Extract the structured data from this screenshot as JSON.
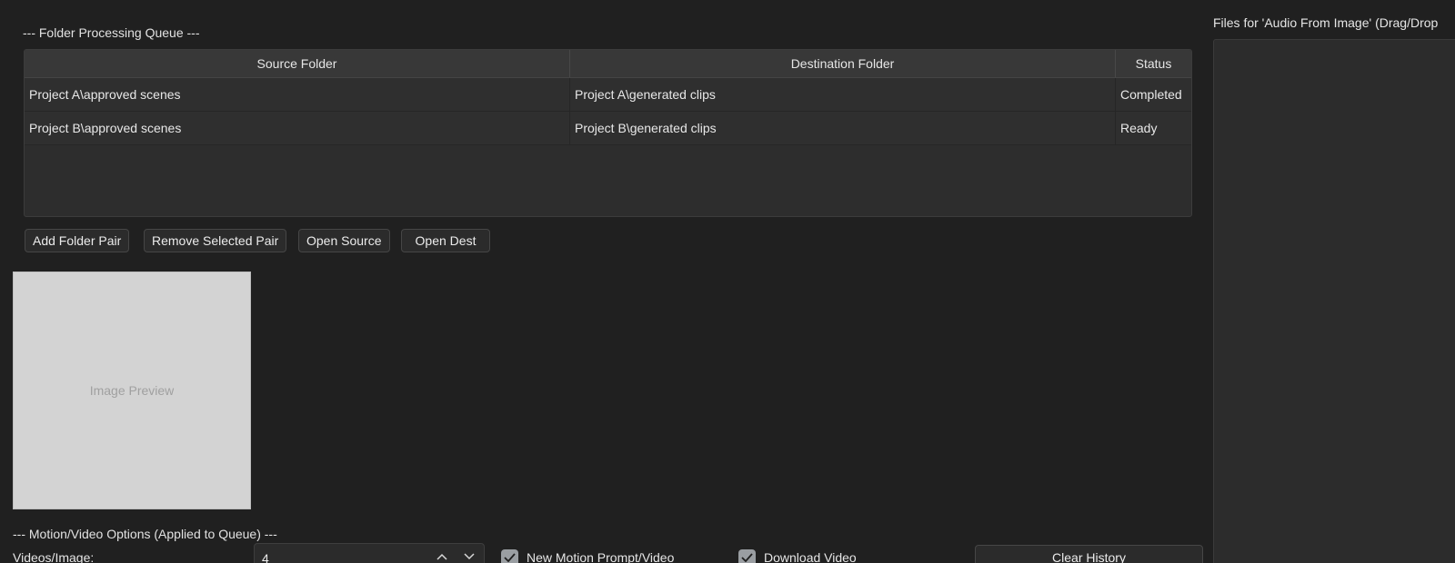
{
  "queue": {
    "title": "--- Folder Processing Queue ---",
    "columns": [
      "Source Folder",
      "Destination Folder",
      "Status"
    ],
    "rows": [
      {
        "source": "Project A\\approved scenes",
        "dest": "Project A\\generated clips",
        "status": "Completed"
      },
      {
        "source": "Project B\\approved scenes",
        "dest": "Project B\\generated clips",
        "status": "Ready"
      }
    ],
    "buttons": {
      "add": "Add Folder Pair",
      "remove": "Remove Selected Pair",
      "open_source": "Open Source",
      "open_dest": "Open Dest"
    }
  },
  "preview": {
    "placeholder": "Image Preview"
  },
  "motion": {
    "title": "--- Motion/Video Options (Applied to Queue) ---",
    "videos_per_image_label": "Videos/Image:",
    "videos_per_image_value": "4",
    "new_motion_prompt_label": "New Motion Prompt/Video",
    "new_motion_prompt_checked": true,
    "download_video_label": "Download Video",
    "download_video_checked": true,
    "clear_history": "Clear History"
  },
  "audio_panel": {
    "title": "Files for 'Audio From Image' (Drag/Drop"
  },
  "icons": {
    "spin_up": "chevron-up-icon",
    "spin_down": "chevron-down-icon",
    "check": "checkmark-icon"
  },
  "colors": {
    "background": "#202020",
    "panel": "#2d2d2d",
    "preview": "#d3d3d3",
    "checkbox": "#9a9ea2"
  }
}
